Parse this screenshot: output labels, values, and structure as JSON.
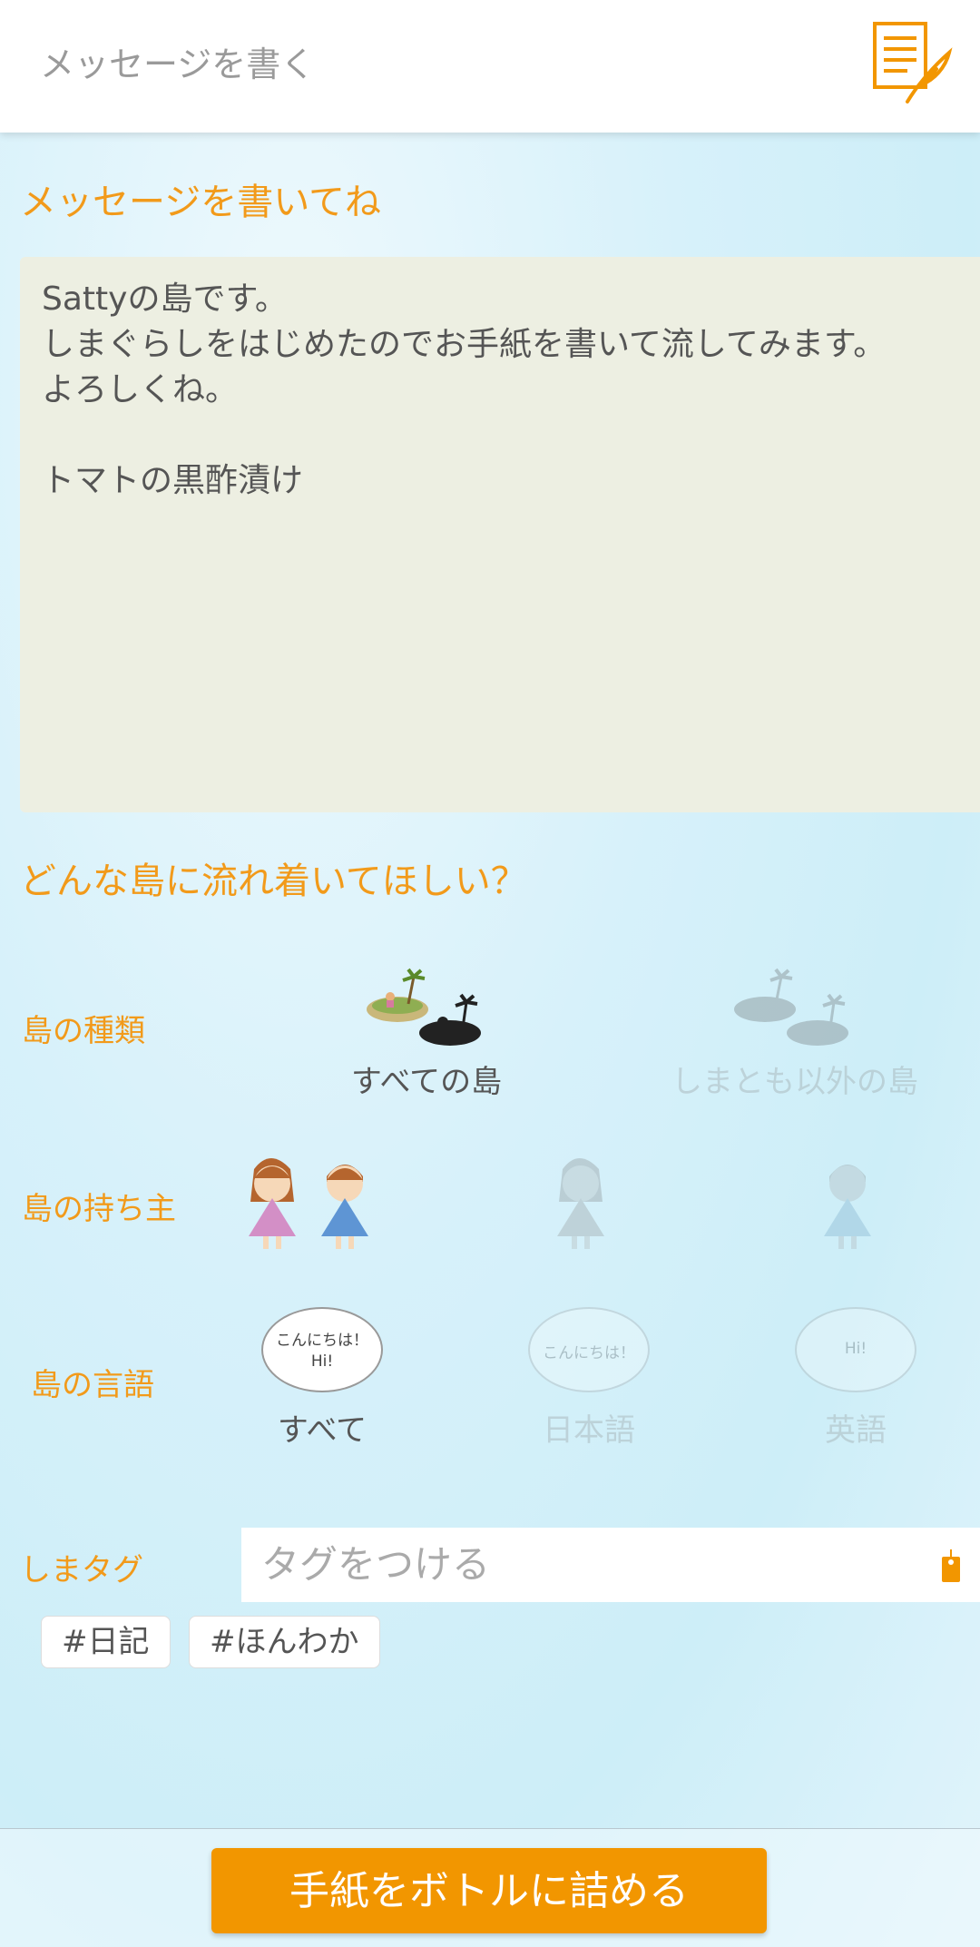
{
  "header": {
    "title": "メッセージを書く",
    "icon": "write-letter-icon"
  },
  "compose": {
    "section_title": "メッセージを書いてね",
    "message": "Sattyの島です。\nしまぐらしをはじめたのでお手紙を書いて流してみます。\nよろしくね。\n\nトマトの黒酢漬け"
  },
  "destination": {
    "section_title": "どんな島に流れ着いてほしい？",
    "island_type": {
      "label": "島の種類",
      "options": [
        {
          "label": "すべての島",
          "selected": true
        },
        {
          "label": "しまとも以外の島",
          "selected": false
        }
      ]
    },
    "owner": {
      "label": "島の持ち主",
      "options": [
        {
          "name": "all-owners",
          "selected": true
        },
        {
          "name": "female-owner",
          "selected": false
        },
        {
          "name": "male-owner",
          "selected": false
        }
      ]
    },
    "language": {
      "label": "島の言語",
      "options": [
        {
          "label": "すべて",
          "bubble_line1": "こんにちは！",
          "bubble_line2": "Hi!",
          "selected": true
        },
        {
          "label": "日本語",
          "bubble_line1": "こんにちは！",
          "selected": false
        },
        {
          "label": "英語",
          "bubble_line1": "Hi!",
          "selected": false
        }
      ]
    }
  },
  "tags": {
    "label": "しまタグ",
    "placeholder": "タグをつける",
    "chips": [
      "#日記",
      "#ほんわか"
    ]
  },
  "footer": {
    "send_label": "手紙をボトルに詰める"
  },
  "colors": {
    "accent": "#f29600",
    "label": "#f29a1a",
    "message_bg": "#edefe2"
  }
}
